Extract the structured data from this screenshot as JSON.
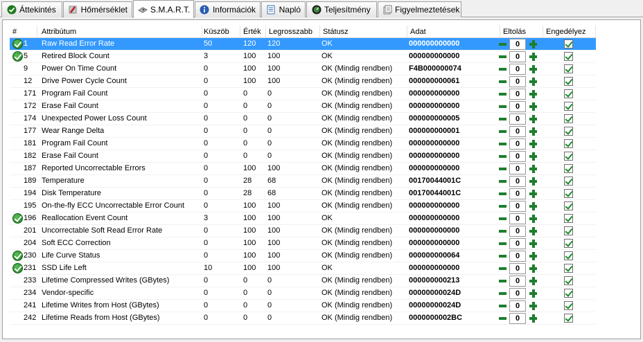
{
  "tabs": [
    {
      "label": "Áttekintés",
      "icon": "check-circle-icon",
      "active": false
    },
    {
      "label": "Hőmérséklet",
      "icon": "thermometer-icon",
      "active": false
    },
    {
      "label": "S.M.A.R.T.",
      "icon": "disk-icon",
      "active": true
    },
    {
      "label": "Információk",
      "icon": "info-icon",
      "active": false
    },
    {
      "label": "Napló",
      "icon": "log-icon",
      "active": false
    },
    {
      "label": "Teljesítmény",
      "icon": "performance-icon",
      "active": false
    },
    {
      "label": "Figyelmeztetések",
      "icon": "warnings-icon",
      "active": false
    }
  ],
  "columns": {
    "id": "#",
    "attribute": "Attribútum",
    "threshold": "Küszöb",
    "value": "Érték",
    "worst": "Legrosszabb",
    "status": "Státusz",
    "data": "Adat",
    "offset": "Eltolás",
    "enabled": "Engedélyez"
  },
  "colors": {
    "selection": "#3399ff",
    "ok_icon": "#2e8b2e",
    "stepper": "#1e7e2e"
  },
  "rows": [
    {
      "ok_icon": true,
      "id": "1",
      "attr": "Raw Read Error Rate",
      "thr": "50",
      "val": "120",
      "worst": "120",
      "status": "OK",
      "raw": "000000000000",
      "offset": "0",
      "enabled": true,
      "selected": true
    },
    {
      "ok_icon": true,
      "id": "5",
      "attr": "Retired Block Count",
      "thr": "3",
      "val": "100",
      "worst": "100",
      "status": "OK",
      "raw": "000000000000",
      "offset": "0",
      "enabled": true
    },
    {
      "ok_icon": false,
      "id": "9",
      "attr": "Power On Time Count",
      "thr": "0",
      "val": "100",
      "worst": "100",
      "status": "OK (Mindig rendben)",
      "raw": "F4B000000074",
      "offset": "0",
      "enabled": true
    },
    {
      "ok_icon": false,
      "id": "12",
      "attr": "Drive Power Cycle Count",
      "thr": "0",
      "val": "100",
      "worst": "100",
      "status": "OK (Mindig rendben)",
      "raw": "000000000061",
      "offset": "0",
      "enabled": true
    },
    {
      "ok_icon": false,
      "id": "171",
      "attr": "Program Fail Count",
      "thr": "0",
      "val": "0",
      "worst": "0",
      "status": "OK (Mindig rendben)",
      "raw": "000000000000",
      "offset": "0",
      "enabled": true
    },
    {
      "ok_icon": false,
      "id": "172",
      "attr": "Erase Fail Count",
      "thr": "0",
      "val": "0",
      "worst": "0",
      "status": "OK (Mindig rendben)",
      "raw": "000000000000",
      "offset": "0",
      "enabled": true
    },
    {
      "ok_icon": false,
      "id": "174",
      "attr": "Unexpected Power Loss Count",
      "thr": "0",
      "val": "0",
      "worst": "0",
      "status": "OK (Mindig rendben)",
      "raw": "000000000005",
      "offset": "0",
      "enabled": true
    },
    {
      "ok_icon": false,
      "id": "177",
      "attr": "Wear Range Delta",
      "thr": "0",
      "val": "0",
      "worst": "0",
      "status": "OK (Mindig rendben)",
      "raw": "000000000001",
      "offset": "0",
      "enabled": true
    },
    {
      "ok_icon": false,
      "id": "181",
      "attr": "Program Fail Count",
      "thr": "0",
      "val": "0",
      "worst": "0",
      "status": "OK (Mindig rendben)",
      "raw": "000000000000",
      "offset": "0",
      "enabled": true
    },
    {
      "ok_icon": false,
      "id": "182",
      "attr": "Erase Fail Count",
      "thr": "0",
      "val": "0",
      "worst": "0",
      "status": "OK (Mindig rendben)",
      "raw": "000000000000",
      "offset": "0",
      "enabled": true
    },
    {
      "ok_icon": false,
      "id": "187",
      "attr": "Reported Uncorrectable Errors",
      "thr": "0",
      "val": "100",
      "worst": "100",
      "status": "OK (Mindig rendben)",
      "raw": "000000000000",
      "offset": "0",
      "enabled": true
    },
    {
      "ok_icon": false,
      "id": "189",
      "attr": "Temperature",
      "thr": "0",
      "val": "28",
      "worst": "68",
      "status": "OK (Mindig rendben)",
      "raw": "00170044001C",
      "offset": "0",
      "enabled": true
    },
    {
      "ok_icon": false,
      "id": "194",
      "attr": "Disk Temperature",
      "thr": "0",
      "val": "28",
      "worst": "68",
      "status": "OK (Mindig rendben)",
      "raw": "00170044001C",
      "offset": "0",
      "enabled": true
    },
    {
      "ok_icon": false,
      "id": "195",
      "attr": "On-the-fly ECC Uncorrectable Error Count",
      "thr": "0",
      "val": "100",
      "worst": "100",
      "status": "OK (Mindig rendben)",
      "raw": "000000000000",
      "offset": "0",
      "enabled": true
    },
    {
      "ok_icon": true,
      "id": "196",
      "attr": "Reallocation Event Count",
      "thr": "3",
      "val": "100",
      "worst": "100",
      "status": "OK",
      "raw": "000000000000",
      "offset": "0",
      "enabled": true
    },
    {
      "ok_icon": false,
      "id": "201",
      "attr": "Uncorrectable Soft Read Error Rate",
      "thr": "0",
      "val": "100",
      "worst": "100",
      "status": "OK (Mindig rendben)",
      "raw": "000000000000",
      "offset": "0",
      "enabled": true
    },
    {
      "ok_icon": false,
      "id": "204",
      "attr": "Soft ECC Correction",
      "thr": "0",
      "val": "100",
      "worst": "100",
      "status": "OK (Mindig rendben)",
      "raw": "000000000000",
      "offset": "0",
      "enabled": true
    },
    {
      "ok_icon": true,
      "id": "230",
      "attr": "Life Curve Status",
      "thr": "0",
      "val": "100",
      "worst": "100",
      "status": "OK (Mindig rendben)",
      "raw": "000000000064",
      "offset": "0",
      "enabled": true
    },
    {
      "ok_icon": true,
      "id": "231",
      "attr": "SSD Life Left",
      "thr": "10",
      "val": "100",
      "worst": "100",
      "status": "OK",
      "raw": "000000000000",
      "offset": "0",
      "enabled": true
    },
    {
      "ok_icon": false,
      "id": "233",
      "attr": "Lifetime Compressed Writes (GBytes)",
      "thr": "0",
      "val": "0",
      "worst": "0",
      "status": "OK (Mindig rendben)",
      "raw": "000000000213",
      "offset": "0",
      "enabled": true
    },
    {
      "ok_icon": false,
      "id": "234",
      "attr": "Vendor-specific",
      "thr": "0",
      "val": "0",
      "worst": "0",
      "status": "OK (Mindig rendben)",
      "raw": "00000000024D",
      "offset": "0",
      "enabled": true
    },
    {
      "ok_icon": false,
      "id": "241",
      "attr": "Lifetime Writes from Host (GBytes)",
      "thr": "0",
      "val": "0",
      "worst": "0",
      "status": "OK (Mindig rendben)",
      "raw": "00000000024D",
      "offset": "0",
      "enabled": true
    },
    {
      "ok_icon": false,
      "id": "242",
      "attr": "Lifetime Reads from Host (GBytes)",
      "thr": "0",
      "val": "0",
      "worst": "0",
      "status": "OK (Mindig rendben)",
      "raw": "0000000002BC",
      "offset": "0",
      "enabled": true
    }
  ]
}
